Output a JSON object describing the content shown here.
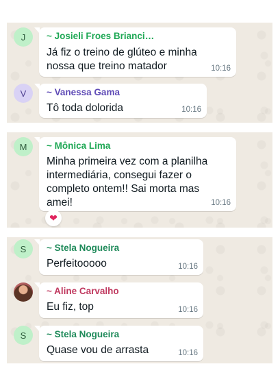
{
  "panels": [
    {
      "messages": [
        {
          "avatar_initial": "J",
          "sender": "~ Josieli Froes Brianci…",
          "sender_color": "#1fa855",
          "text": "Já fiz o treino de glúteo e minha nossa que treino matador",
          "time": "10:16"
        },
        {
          "avatar_initial": "V",
          "sender": "~ Vanessa Gama",
          "sender_color": "#5f4bb6",
          "text": "Tô toda dolorida",
          "time": "10:16"
        }
      ]
    },
    {
      "messages": [
        {
          "avatar_initial": "M",
          "sender": "~ Mônica Lima",
          "sender_color": "#1fa855",
          "text": "Minha primeira vez com a planilha intermediária, consegui fazer o completo ontem!! Sai morta mas amei!",
          "time": "10:16",
          "reaction": "❤"
        }
      ]
    },
    {
      "messages": [
        {
          "avatar_initial": "S",
          "sender": "~ Stela Nogueira",
          "sender_color": "#1f8a5a",
          "text": "Perfeitooooo",
          "time": "10:16"
        },
        {
          "avatar_icon": "profile-photo",
          "sender": "~ Aline Carvalho",
          "sender_color": "#c0395f",
          "text": "Eu fiz, top",
          "time": "10:16"
        },
        {
          "avatar_initial": "S",
          "sender": "~ Stela Nogueira",
          "sender_color": "#1f8a5a",
          "text": "Quase vou de arrasta",
          "time": "10:16"
        }
      ]
    }
  ]
}
